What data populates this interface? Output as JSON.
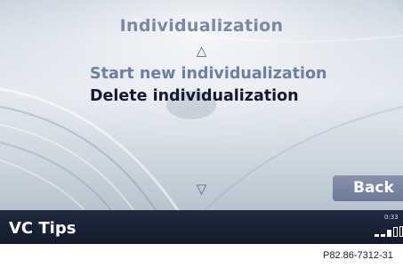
{
  "menu": {
    "title": "Individualization",
    "items": [
      {
        "label": "Start new individualization"
      },
      {
        "label": "Delete individualization"
      }
    ],
    "back_label": "Back"
  },
  "status_bar": {
    "label": "VC Tips",
    "clock": "0:33",
    "signal_icon": "signal-strength-icon"
  },
  "caption": "P82.86-7312-31",
  "icons": {
    "scroll_up": "scroll-up-icon",
    "scroll_down": "scroll-down-icon"
  },
  "colors": {
    "title": "#7a8aa5",
    "item_inactive": "#6f7fa0",
    "item_selected": "#141a2c",
    "status_bar": "#18203a",
    "back_button": "#7782a0"
  }
}
